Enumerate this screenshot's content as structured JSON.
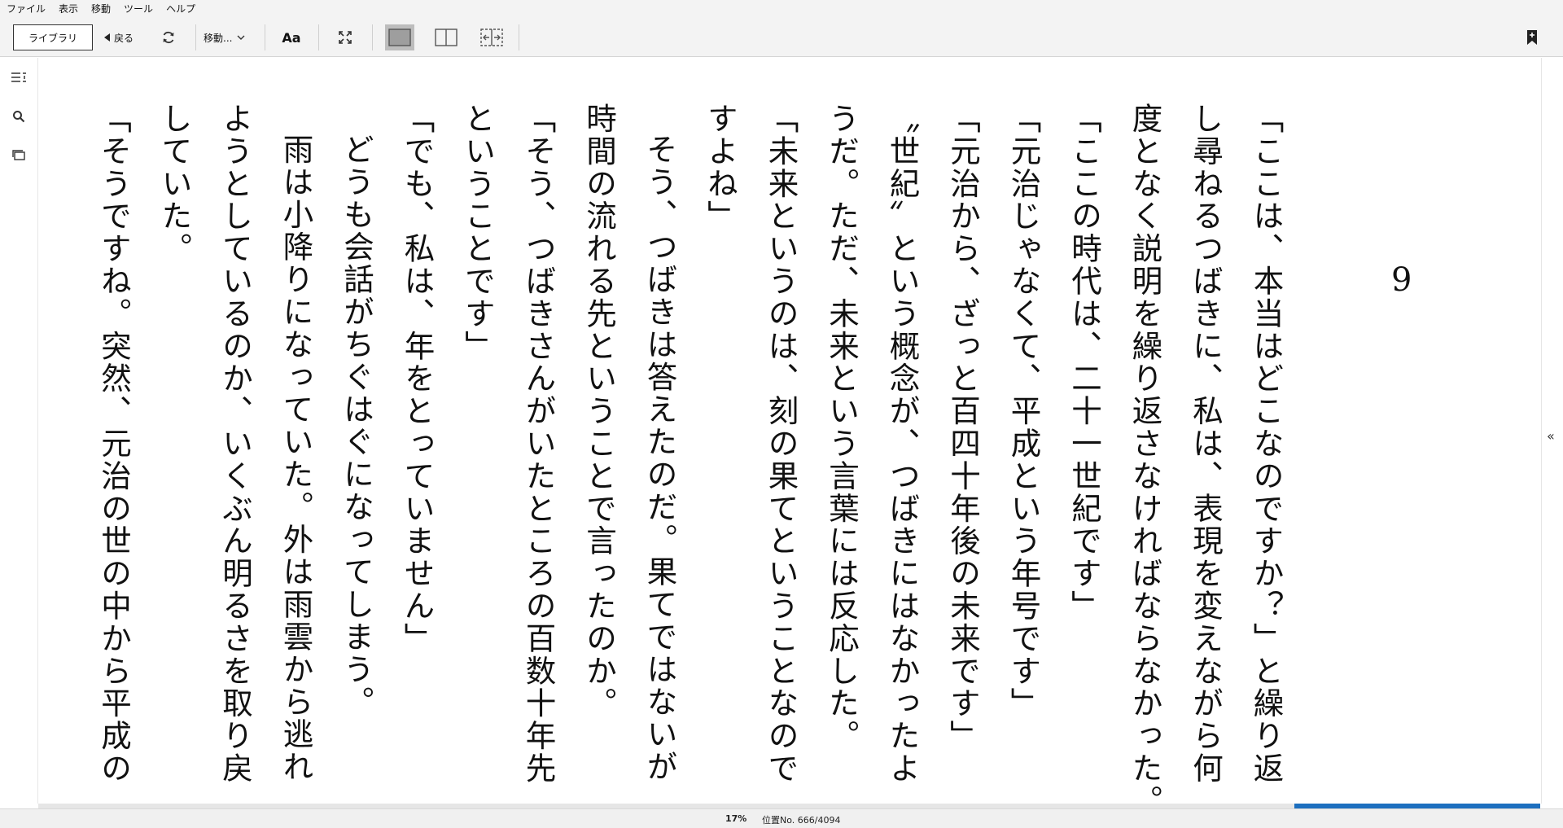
{
  "menu": [
    "ファイル",
    "表示",
    "移動",
    "ツール",
    "ヘルプ"
  ],
  "toolbar": {
    "library_label": "ライブラリ",
    "back_label": "戻る",
    "move_label": "移動...",
    "font_label": "Aa",
    "active_layout": "single-page"
  },
  "sidebar": {
    "icons": [
      "table-of-contents-icon",
      "search-icon",
      "flashcards-icon"
    ]
  },
  "chapter_number": "9",
  "page_text": [
    {
      "indent": false,
      "text": "「ここは、本当はどこなのですか？」と繰り返"
    },
    {
      "indent": false,
      "text": "し尋ねるつばきに、私は、表現を変えながら何"
    },
    {
      "indent": false,
      "text": "度となく説明を繰り返さなければならなかった。"
    },
    {
      "indent": false,
      "text": "「ここの時代は、二十一世紀です」"
    },
    {
      "indent": false,
      "text": "「元治じゃなくて、平成という年号です」"
    },
    {
      "indent": false,
      "text": "「元治から、ざっと百四十年後の未来です」"
    },
    {
      "indent": false,
      "text": "〝世紀〟という概念が、つばきにはなかったよ"
    },
    {
      "indent": false,
      "text": "うだ。ただ、未来という言葉には反応した。"
    },
    {
      "indent": false,
      "text": "「未来というのは、刻の果てということなので"
    },
    {
      "indent": false,
      "text": "すよね」"
    },
    {
      "indent": true,
      "text": "そう、つばきは答えたのだ。果てではないが"
    },
    {
      "indent": false,
      "text": "時間の流れる先ということで言ったのか。"
    },
    {
      "indent": false,
      "text": "「そう、つばきさんがいたところの百数十年先"
    },
    {
      "indent": false,
      "text": "ということです」"
    },
    {
      "indent": false,
      "text": "「でも、私は、年をとっていません」"
    },
    {
      "indent": true,
      "text": "どうも会話がちぐはぐになってしまう。"
    },
    {
      "indent": true,
      "text": "雨は小降りになっていた。外は雨雲から逃れ"
    },
    {
      "indent": false,
      "text": "ようとしているのか、いくぶん明るさを取り戻"
    },
    {
      "indent": false,
      "text": "していた。"
    },
    {
      "indent": false,
      "text": "「そうですね。突然、元治の世の中から平成の"
    }
  ],
  "status": {
    "progress_percent": "17%",
    "location": "位置No. 666/4094",
    "progress_fraction": 0.17
  }
}
